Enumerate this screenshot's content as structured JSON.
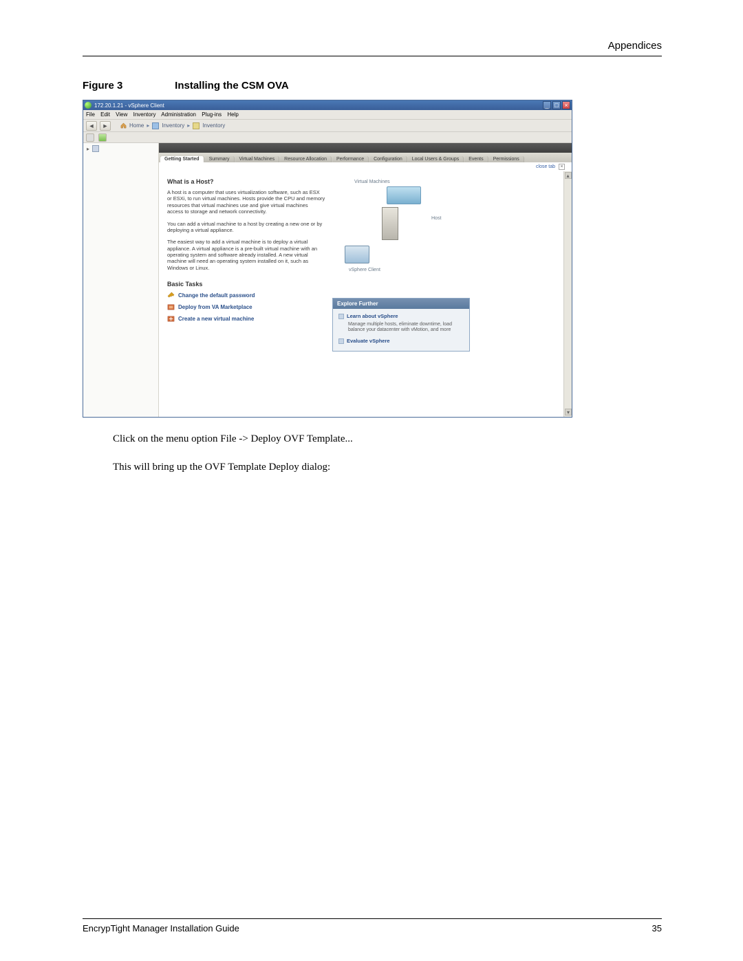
{
  "page": {
    "header_right": "Appendices",
    "figure_label": "Figure 3",
    "figure_title": "Installing the CSM OVA",
    "body_para_1": "Click on the menu option File -> Deploy OVF Template...",
    "body_para_2": "This will bring up the OVF Template Deploy dialog:",
    "footer_left": "EncrypTight Manager Installation Guide",
    "footer_right": "35"
  },
  "window": {
    "title": "172.20.1.21 - vSphere Client",
    "menus": [
      "File",
      "Edit",
      "View",
      "Inventory",
      "Administration",
      "Plug-ins",
      "Help"
    ],
    "breadcrumb": {
      "home": "Home",
      "sep": "▸",
      "inv1": "Inventory",
      "inv2": "Inventory"
    },
    "tabs": [
      "Getting Started",
      "Summary",
      "Virtual Machines",
      "Resource Allocation",
      "Performance",
      "Configuration",
      "Local Users & Groups",
      "Events",
      "Permissions"
    ],
    "close_tab": "close tab",
    "getting_started": {
      "heading": "What is a Host?",
      "p1": "A host is a computer that uses virtualization software, such as ESX or ESXi, to run virtual machines. Hosts provide the CPU and memory resources that virtual machines use and give virtual machines access to storage and network connectivity.",
      "p2": "You can add a virtual machine to a host by creating a new one or by deploying a virtual appliance.",
      "p3": "The easiest way to add a virtual machine is to deploy a virtual appliance. A virtual appliance is a pre-built virtual machine with an operating system and software already installed. A new virtual machine will need an operating system installed on it, such as Windows or Linux.",
      "basic_tasks_heading": "Basic Tasks",
      "task1": "Change the default password",
      "task2": "Deploy from VA Marketplace",
      "task3": "Create a new virtual machine"
    },
    "diagram": {
      "vm_label": "Virtual Machines",
      "host_label": "Host",
      "client_label": "vSphere Client"
    },
    "explore": {
      "heading": "Explore Further",
      "item1": "Learn about vSphere",
      "item1_sub": "Manage multiple hosts, eliminate downtime, load balance your datacenter with vMotion, and more",
      "item2": "Evaluate vSphere"
    }
  }
}
